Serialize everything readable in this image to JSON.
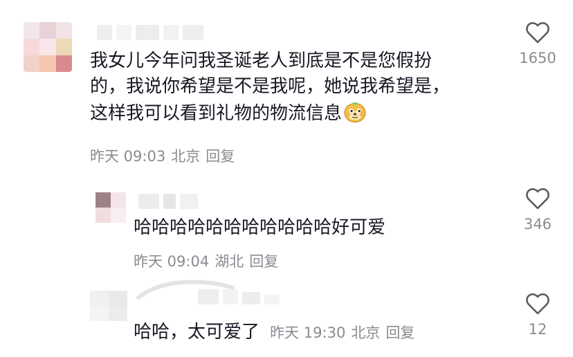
{
  "comments": [
    {
      "text_lines": [
        "我女儿今年问我圣诞老人到底是不是您假扮",
        "的，我说你希望是不是我呢，她说我希望是，",
        "这样我可以看到礼物的物流信息"
      ],
      "emoji": "doge-emoji-icon",
      "time": "昨天 09:03",
      "location": "北京",
      "reply_label": "回复",
      "likes": "1650"
    },
    {
      "text": "哈哈哈哈哈哈哈哈哈哈哈好可爱",
      "time": "昨天 09:04",
      "location": "湖北",
      "reply_label": "回复",
      "likes": "346"
    },
    {
      "text": "哈哈，太可爱了",
      "time": "昨天 19:30",
      "location": "北京",
      "reply_label": "回复",
      "likes": "12"
    }
  ],
  "colors": {
    "text": "#161823",
    "meta": "#8a8b91",
    "icon": "#5a5b62"
  }
}
